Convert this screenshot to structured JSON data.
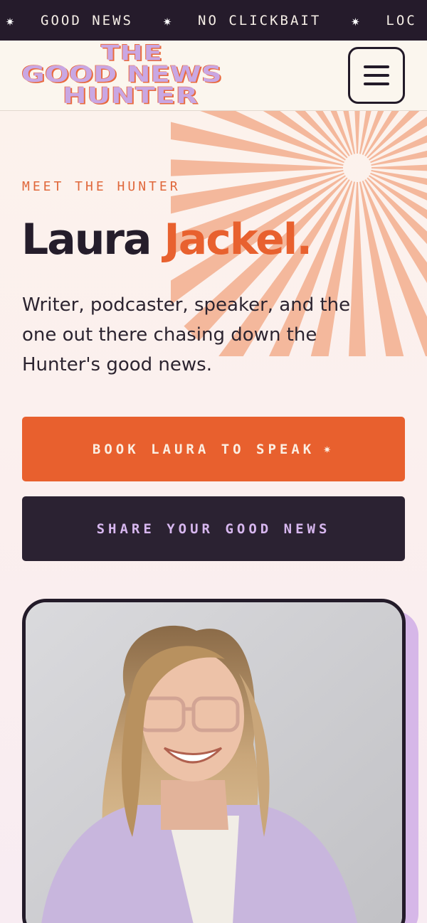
{
  "ticker": {
    "items": [
      "GOOD NEWS",
      "NO CLICKBAIT",
      "LOC"
    ],
    "separator_icon": "star-icon"
  },
  "header": {
    "logo": {
      "line1": "THE",
      "line2": "GOOD NEWS",
      "line3": "HUNTER"
    },
    "menu_icon": "hamburger-icon"
  },
  "hero": {
    "eyebrow": "MEET THE HUNTER",
    "name_first": "Laura",
    "name_last": "Jackel.",
    "bio": "Writer, podcaster, speaker, and the one out there chasing down the Hunter's good news."
  },
  "buttons": {
    "book": "BOOK LAURA TO SPEAK",
    "book_icon": "sparkle-icon",
    "share": "SHARE YOUR GOOD NEWS"
  },
  "photo": {
    "subject": "portrait-photo"
  },
  "colors": {
    "accent_orange": "#e8602e",
    "dark": "#2b2232",
    "lavender": "#d6b7e8",
    "cream": "#fbf6ee",
    "sunburst": "#f4b89c"
  }
}
